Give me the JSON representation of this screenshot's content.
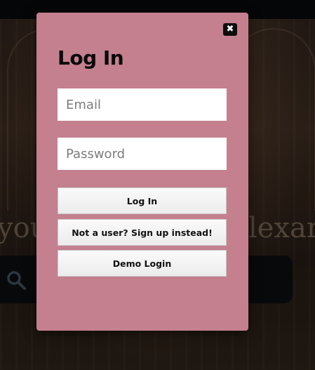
{
  "background": {
    "heading_left": "you",
    "heading_right": "lexar"
  },
  "modal": {
    "close_label": "✖",
    "title": "Log In",
    "email_placeholder": "Email",
    "password_placeholder": "Password",
    "login_button": "Log In",
    "signup_button": "Not a user? Sign up instead!",
    "demo_button": "Demo Login"
  },
  "colors": {
    "modal_bg": "#c4808f",
    "button_bg": "#f2f2f2"
  }
}
